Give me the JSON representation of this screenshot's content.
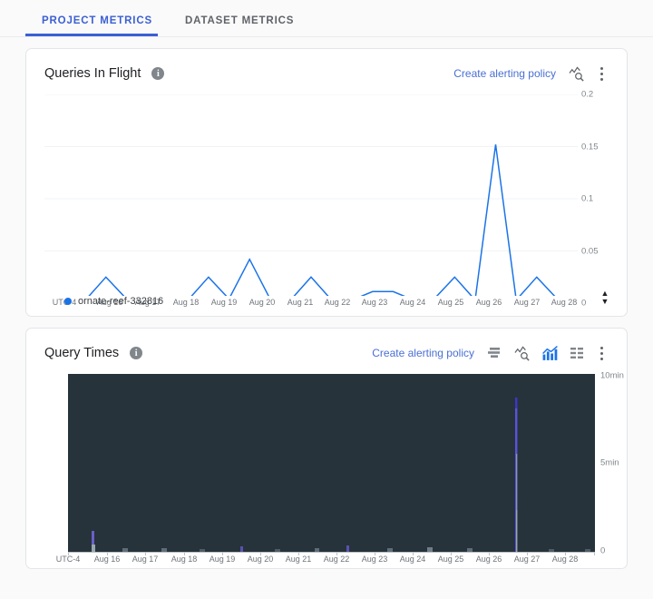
{
  "tabs": [
    {
      "label": "PROJECT METRICS",
      "active": true
    },
    {
      "label": "DATASET METRICS",
      "active": false
    }
  ],
  "accent_color": "#3b5fd4",
  "link_color": "#4a6fd4",
  "charts": [
    {
      "title": "Queries In Flight",
      "info_glyph": "i",
      "alert_link": "Create alerting policy",
      "toolbar": [
        {
          "name": "inspect-metric-icon",
          "active": false
        },
        {
          "name": "more-options-icon",
          "active": false
        }
      ],
      "legend": [
        {
          "label": "ornate-reef-332816",
          "color": "#1a73e8"
        }
      ],
      "chart_data": {
        "type": "line",
        "title": "Queries In Flight",
        "xlabel": "",
        "ylabel": "",
        "timezone_label": "UTC-4",
        "xticks": [
          "UTC-4",
          "Aug 16",
          "Aug 17",
          "Aug 18",
          "Aug 19",
          "Aug 20",
          "Aug 21",
          "Aug 22",
          "Aug 23",
          "Aug 24",
          "Aug 25",
          "Aug 26",
          "Aug 27",
          "Aug 28"
        ],
        "yticks": [
          "0",
          "0.05",
          "0.1",
          "0.15",
          "0.2"
        ],
        "ylim": [
          0,
          0.2
        ],
        "grid": true,
        "legend_position": "bottom-left",
        "series": [
          {
            "name": "ornate-reef-332816",
            "color": "#1a73e8",
            "points": [
              {
                "t": "Aug 15 20:00",
                "v": 0.004
              },
              {
                "t": "Aug 16 00:00",
                "v": 0.003
              },
              {
                "t": "Aug 16 06:00",
                "v": 0.003
              },
              {
                "t": "Aug 16 11:00",
                "v": 0.025
              },
              {
                "t": "Aug 16 14:00",
                "v": 0.004
              },
              {
                "t": "Aug 17 00:00",
                "v": 0.003
              },
              {
                "t": "Aug 17 12:00",
                "v": 0.003
              },
              {
                "t": "Aug 18 00:00",
                "v": 0.003
              },
              {
                "t": "Aug 18 12:00",
                "v": 0.025
              },
              {
                "t": "Aug 18 18:00",
                "v": 0.004
              },
              {
                "t": "Aug 19 06:00",
                "v": 0.042
              },
              {
                "t": "Aug 19 12:00",
                "v": 0.004
              },
              {
                "t": "Aug 20 00:00",
                "v": 0.003
              },
              {
                "t": "Aug 20 12:00",
                "v": 0.025
              },
              {
                "t": "Aug 21 00:00",
                "v": 0.003
              },
              {
                "t": "Aug 22 00:00",
                "v": 0.003
              },
              {
                "t": "Aug 23 06:00",
                "v": 0.011
              },
              {
                "t": "Aug 23 18:00",
                "v": 0.011
              },
              {
                "t": "Aug 24 12:00",
                "v": 0.003
              },
              {
                "t": "Aug 25 12:00",
                "v": 0.004
              },
              {
                "t": "Aug 26 06:00",
                "v": 0.025
              },
              {
                "t": "Aug 26 18:00",
                "v": 0.003
              },
              {
                "t": "Aug 27 00:00",
                "v": 0.152
              },
              {
                "t": "Aug 27 06:00",
                "v": 0.003
              },
              {
                "t": "Aug 27 18:00",
                "v": 0.025
              },
              {
                "t": "Aug 28 06:00",
                "v": 0.004
              },
              {
                "t": "Aug 28 18:00",
                "v": 0.003
              }
            ]
          }
        ]
      }
    },
    {
      "title": "Query Times",
      "info_glyph": "i",
      "alert_link": "Create alerting policy",
      "toolbar": [
        {
          "name": "heatmap-view-icon",
          "active": false
        },
        {
          "name": "inspect-metric-icon",
          "active": false
        },
        {
          "name": "chart-view-icon",
          "active": true
        },
        {
          "name": "table-view-icon",
          "active": false
        },
        {
          "name": "more-options-icon",
          "active": false
        }
      ],
      "chart_data": {
        "type": "heatmap",
        "title": "Query Times",
        "xlabel": "",
        "ylabel": "",
        "timezone_label": "UTC-4",
        "xticks": [
          "UTC-4",
          "Aug 16",
          "Aug 17",
          "Aug 18",
          "Aug 19",
          "Aug 20",
          "Aug 21",
          "Aug 22",
          "Aug 23",
          "Aug 24",
          "Aug 25",
          "Aug 26",
          "Aug 27",
          "Aug 28"
        ],
        "yticks": [
          "0",
          "5min",
          "10min"
        ],
        "ylim": [
          0,
          10
        ],
        "background_color": "#26333b",
        "grid": false,
        "legend_position": "none",
        "cells": [
          {
            "t": "Aug 16 02:00",
            "v": 1.05,
            "color": "#6a5fc8"
          },
          {
            "t": "Aug 16 10:00",
            "v": 0.15,
            "color": "#7b8a94"
          },
          {
            "t": "Aug 17 06:00",
            "v": 0.12,
            "color": "#6f7d88"
          },
          {
            "t": "Aug 18 08:00",
            "v": 0.1,
            "color": "#5a6b78"
          },
          {
            "t": "Aug 19 04:00",
            "v": 0.3,
            "color": "#5b52b0"
          },
          {
            "t": "Aug 20 12:00",
            "v": 0.1,
            "color": "#5a6b78"
          },
          {
            "t": "Aug 21 16:00",
            "v": 0.18,
            "color": "#7b8a94"
          },
          {
            "t": "Aug 22 10:00",
            "v": 0.1,
            "color": "#5a6b78"
          },
          {
            "t": "Aug 23 06:00",
            "v": 0.45,
            "color": "#5b52b0"
          },
          {
            "t": "Aug 24 10:00",
            "v": 0.14,
            "color": "#6f7d88"
          },
          {
            "t": "Aug 25 14:00",
            "v": 0.2,
            "color": "#7b8a94"
          },
          {
            "t": "Aug 26 06:00",
            "v": 0.16,
            "color": "#6f7d88"
          },
          {
            "t": "Aug 27 00:00",
            "v": 9.6,
            "color": "#5b52d8"
          },
          {
            "t": "Aug 27 12:00",
            "v": 0.12,
            "color": "#6f7d88"
          },
          {
            "t": "Aug 28 08:00",
            "v": 0.14,
            "color": "#6f7d88"
          }
        ]
      }
    }
  ]
}
